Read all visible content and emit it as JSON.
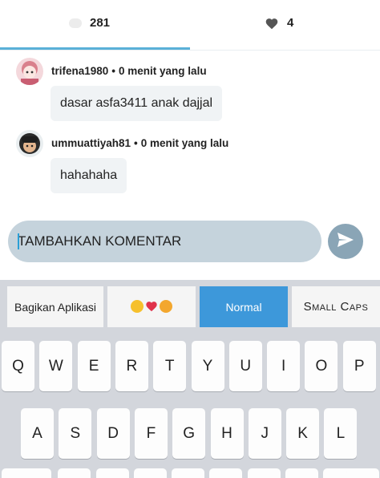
{
  "stats": {
    "comment_count": "281",
    "like_count": "4"
  },
  "comments": [
    {
      "username": "trifena1980",
      "time": "0 menit yang lalu",
      "text": "dasar asfa3411 anak dajjal"
    },
    {
      "username": "ummuattiyah81",
      "time": "0 menit yang lalu",
      "text": "hahahaha"
    }
  ],
  "composer": {
    "placeholder": "TAMBAHKAN KOMENTAR"
  },
  "keyboard": {
    "options": {
      "share": "Bagikan Aplikasi",
      "normal": "Normal",
      "small_caps": "Small Caps"
    },
    "row1": [
      "Q",
      "W",
      "E",
      "R",
      "T",
      "Y",
      "U",
      "I",
      "O",
      "P"
    ],
    "row2": [
      "A",
      "S",
      "D",
      "F",
      "G",
      "H",
      "J",
      "K",
      "L"
    ]
  },
  "colors": {
    "accent": "#5ab0d8",
    "selected_option": "#3d98da",
    "composer_bg": "#c5d3dc",
    "send_button": "#8aa5b6"
  }
}
